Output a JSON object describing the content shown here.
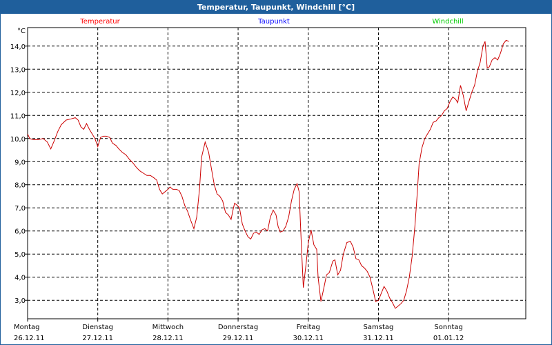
{
  "window": {
    "title": "Temperatur, Taupunkt, Windchill [°C]"
  },
  "chart_data": {
    "type": "line",
    "title": "Temperatur, Taupunkt, Windchill [°C]",
    "ylabel": "°C",
    "ylim": [
      2.2,
      14.8
    ],
    "xlim": [
      0,
      7.1
    ],
    "grid": true,
    "legend": [
      {
        "name": "Temperatur",
        "color": "#ff0000"
      },
      {
        "name": "Taupunkt",
        "color": "#0000ff"
      },
      {
        "name": "Windchill",
        "color": "#00cc00"
      }
    ],
    "yticks": [
      {
        "v": 3.0,
        "label": "3,0"
      },
      {
        "v": 4.0,
        "label": "4,0"
      },
      {
        "v": 5.0,
        "label": "5,0"
      },
      {
        "v": 6.0,
        "label": "6,0"
      },
      {
        "v": 7.0,
        "label": "7,0"
      },
      {
        "v": 8.0,
        "label": "8,0"
      },
      {
        "v": 9.0,
        "label": "9,0"
      },
      {
        "v": 10.0,
        "label": "10,0"
      },
      {
        "v": 11.0,
        "label": "11,0"
      },
      {
        "v": 12.0,
        "label": "12,0"
      },
      {
        "v": 13.0,
        "label": "13,0"
      },
      {
        "v": 14.0,
        "label": "14,0"
      }
    ],
    "xticks": [
      {
        "v": 0,
        "day": "Montag",
        "date": "26.12.11"
      },
      {
        "v": 1,
        "day": "Dienstag",
        "date": "27.12.11"
      },
      {
        "v": 2,
        "day": "Mittwoch",
        "date": "28.12.11"
      },
      {
        "v": 3,
        "day": "Donnerstag",
        "date": "29.12.11"
      },
      {
        "v": 4,
        "day": "Freitag",
        "date": "30.12.11"
      },
      {
        "v": 5,
        "day": "Samstag",
        "date": "31.12.11"
      },
      {
        "v": 6,
        "day": "Sonntag",
        "date": "01.01.12"
      }
    ],
    "series": [
      {
        "name": "Temperatur",
        "color": "#cc0000",
        "points": [
          [
            0.0,
            10.2
          ],
          [
            0.03,
            10.0
          ],
          [
            0.08,
            9.95
          ],
          [
            0.15,
            9.95
          ],
          [
            0.22,
            10.0
          ],
          [
            0.28,
            9.85
          ],
          [
            0.33,
            9.55
          ],
          [
            0.38,
            9.9
          ],
          [
            0.43,
            10.3
          ],
          [
            0.48,
            10.6
          ],
          [
            0.55,
            10.8
          ],
          [
            0.62,
            10.85
          ],
          [
            0.68,
            10.9
          ],
          [
            0.72,
            10.8
          ],
          [
            0.76,
            10.5
          ],
          [
            0.8,
            10.4
          ],
          [
            0.84,
            10.65
          ],
          [
            0.88,
            10.4
          ],
          [
            0.92,
            10.2
          ],
          [
            0.96,
            10.0
          ],
          [
            1.0,
            9.65
          ],
          [
            1.04,
            10.05
          ],
          [
            1.08,
            10.1
          ],
          [
            1.12,
            10.1
          ],
          [
            1.17,
            10.05
          ],
          [
            1.21,
            9.8
          ],
          [
            1.26,
            9.7
          ],
          [
            1.3,
            9.55
          ],
          [
            1.35,
            9.4
          ],
          [
            1.4,
            9.3
          ],
          [
            1.45,
            9.1
          ],
          [
            1.5,
            8.95
          ],
          [
            1.55,
            8.75
          ],
          [
            1.6,
            8.6
          ],
          [
            1.65,
            8.5
          ],
          [
            1.7,
            8.4
          ],
          [
            1.75,
            8.4
          ],
          [
            1.8,
            8.3
          ],
          [
            1.84,
            8.2
          ],
          [
            1.88,
            7.8
          ],
          [
            1.92,
            7.6
          ],
          [
            1.96,
            7.7
          ],
          [
            2.0,
            7.8
          ],
          [
            2.03,
            7.9
          ],
          [
            2.07,
            7.8
          ],
          [
            2.12,
            7.8
          ],
          [
            2.16,
            7.75
          ],
          [
            2.2,
            7.5
          ],
          [
            2.24,
            7.1
          ],
          [
            2.28,
            6.85
          ],
          [
            2.32,
            6.5
          ],
          [
            2.37,
            6.1
          ],
          [
            2.41,
            6.6
          ],
          [
            2.45,
            7.8
          ],
          [
            2.48,
            9.2
          ],
          [
            2.53,
            9.85
          ],
          [
            2.58,
            9.4
          ],
          [
            2.62,
            8.7
          ],
          [
            2.66,
            8.0
          ],
          [
            2.7,
            7.6
          ],
          [
            2.74,
            7.5
          ],
          [
            2.78,
            7.3
          ],
          [
            2.82,
            6.8
          ],
          [
            2.86,
            6.7
          ],
          [
            2.9,
            6.5
          ],
          [
            2.93,
            6.95
          ],
          [
            2.95,
            7.2
          ],
          [
            2.99,
            7.1
          ],
          [
            3.02,
            7.0
          ],
          [
            3.06,
            6.3
          ],
          [
            3.1,
            6.0
          ],
          [
            3.14,
            5.75
          ],
          [
            3.18,
            5.65
          ],
          [
            3.22,
            5.9
          ],
          [
            3.26,
            5.95
          ],
          [
            3.3,
            5.85
          ],
          [
            3.34,
            6.05
          ],
          [
            3.38,
            6.1
          ],
          [
            3.42,
            6.0
          ],
          [
            3.46,
            6.6
          ],
          [
            3.5,
            6.9
          ],
          [
            3.54,
            6.7
          ],
          [
            3.57,
            6.2
          ],
          [
            3.6,
            5.95
          ],
          [
            3.64,
            6.0
          ],
          [
            3.68,
            6.2
          ],
          [
            3.72,
            6.6
          ],
          [
            3.76,
            7.3
          ],
          [
            3.8,
            7.8
          ],
          [
            3.84,
            8.05
          ],
          [
            3.87,
            7.7
          ],
          [
            3.9,
            5.5
          ],
          [
            3.93,
            3.55
          ],
          [
            3.97,
            4.6
          ],
          [
            4.0,
            5.5
          ],
          [
            4.04,
            6.05
          ],
          [
            4.08,
            5.4
          ],
          [
            4.12,
            5.2
          ],
          [
            4.14,
            4.0
          ],
          [
            4.18,
            2.95
          ],
          [
            4.22,
            3.5
          ],
          [
            4.26,
            4.1
          ],
          [
            4.3,
            4.2
          ],
          [
            4.35,
            4.7
          ],
          [
            4.38,
            4.75
          ],
          [
            4.42,
            4.1
          ],
          [
            4.46,
            4.3
          ],
          [
            4.5,
            5.0
          ],
          [
            4.55,
            5.5
          ],
          [
            4.6,
            5.55
          ],
          [
            4.64,
            5.3
          ],
          [
            4.68,
            4.8
          ],
          [
            4.72,
            4.75
          ],
          [
            4.76,
            4.5
          ],
          [
            4.8,
            4.4
          ],
          [
            4.84,
            4.25
          ],
          [
            4.88,
            4.0
          ],
          [
            4.92,
            3.5
          ],
          [
            4.96,
            2.95
          ],
          [
            5.0,
            3.0
          ],
          [
            5.04,
            3.3
          ],
          [
            5.08,
            3.6
          ],
          [
            5.12,
            3.4
          ],
          [
            5.16,
            3.1
          ],
          [
            5.2,
            2.9
          ],
          [
            5.24,
            2.65
          ],
          [
            5.28,
            2.75
          ],
          [
            5.32,
            2.85
          ],
          [
            5.36,
            3.0
          ],
          [
            5.4,
            3.4
          ],
          [
            5.44,
            4.0
          ],
          [
            5.48,
            4.9
          ],
          [
            5.52,
            6.2
          ],
          [
            5.55,
            7.5
          ],
          [
            5.58,
            8.9
          ],
          [
            5.62,
            9.6
          ],
          [
            5.66,
            10.0
          ],
          [
            5.7,
            10.2
          ],
          [
            5.74,
            10.4
          ],
          [
            5.78,
            10.7
          ],
          [
            5.82,
            10.75
          ],
          [
            5.86,
            10.9
          ],
          [
            5.9,
            11.0
          ],
          [
            5.94,
            11.2
          ],
          [
            5.98,
            11.3
          ],
          [
            6.02,
            11.6
          ],
          [
            6.06,
            11.8
          ],
          [
            6.1,
            11.7
          ],
          [
            6.13,
            11.55
          ],
          [
            6.17,
            12.3
          ],
          [
            6.21,
            11.85
          ],
          [
            6.25,
            11.2
          ],
          [
            6.29,
            11.6
          ],
          [
            6.33,
            12.0
          ],
          [
            6.37,
            12.3
          ],
          [
            6.41,
            12.9
          ],
          [
            6.45,
            13.3
          ],
          [
            6.49,
            14.0
          ],
          [
            6.52,
            14.2
          ],
          [
            6.55,
            13.05
          ],
          [
            6.58,
            13.1
          ],
          [
            6.62,
            13.4
          ],
          [
            6.66,
            13.5
          ],
          [
            6.7,
            13.4
          ],
          [
            6.74,
            13.7
          ],
          [
            6.78,
            14.1
          ],
          [
            6.82,
            14.25
          ],
          [
            6.86,
            14.2
          ]
        ]
      }
    ]
  }
}
